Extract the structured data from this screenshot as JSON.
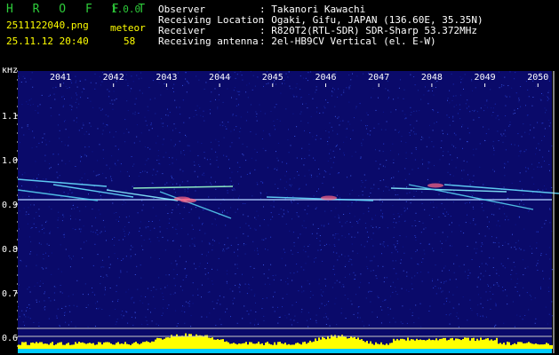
{
  "header": {
    "app_name": "H R O F F T",
    "version": "1.0.0",
    "filename": "2511122040.png",
    "datetime": "25.11.12 20:40",
    "counter_label": "meteor",
    "counter_value": "58",
    "fields": [
      {
        "label": "Observer",
        "value": ": Takanori Kawachi"
      },
      {
        "label": "Receiving Location",
        "value": ": Ogaki, Gifu, JAPAN (136.60E, 35.35N)"
      },
      {
        "label": "Receiver",
        "value": ": R820T2(RTL-SDR) SDR-Sharp 53.372MHz"
      },
      {
        "label": "Receiving antenna",
        "value": ": 2el-HB9CV Vertical (el. E-W)"
      }
    ]
  },
  "chart_data": {
    "type": "heatmap",
    "ylabel": "kHz",
    "ylim": [
      0.57,
      1.29
    ],
    "y_ticks": [
      "1.1",
      "1.0",
      "0.9",
      "0.8",
      "0.7",
      "0.6"
    ],
    "y_tick_values": [
      1.1,
      1.0,
      0.9,
      0.8,
      0.7,
      0.6
    ],
    "x_ticks": [
      "2041",
      "2042",
      "2043",
      "2044",
      "2045",
      "2046",
      "2047",
      "2048",
      "2049",
      "2050"
    ],
    "carrier_kHz": 0.91,
    "colors": {
      "background": "#0a0a6a",
      "axis": "#ffffff",
      "carrier": "#aaccff",
      "power": "#ffff00",
      "floor": "#00ccff"
    }
  }
}
